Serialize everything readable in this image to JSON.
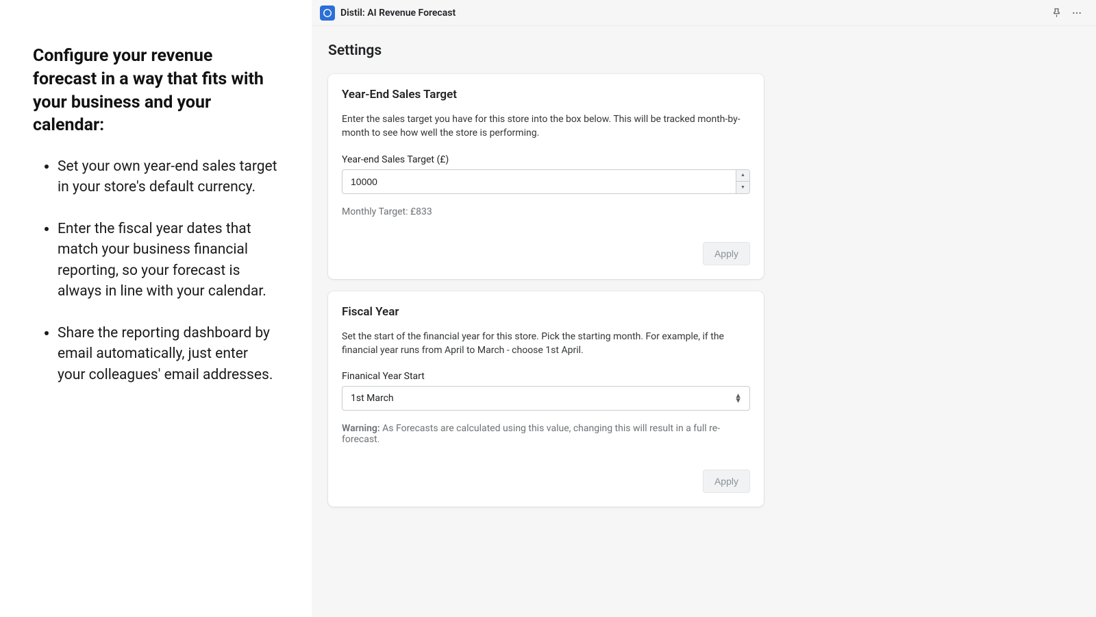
{
  "left": {
    "heading": "Configure your revenue forecast in a way that fits with your business and your calendar:",
    "bullets": [
      "Set your own year-end sales target in your store's default currency.",
      "Enter the fiscal year dates that match your business financial reporting, so your forecast is always in line with your calendar.",
      "Share the reporting dashboard by email automatically, just enter your colleagues' email addresses."
    ]
  },
  "header": {
    "app_title": "Distil: AI Revenue Forecast"
  },
  "page": {
    "title": "Settings"
  },
  "card_target": {
    "title": "Year-End Sales Target",
    "desc": "Enter the sales target you have for this store into the box below. This will be tracked month-by-month to see how well the store is performing.",
    "field_label": "Year-end Sales Target (£)",
    "value": "10000",
    "monthly": "Monthly Target: £833",
    "apply": "Apply"
  },
  "card_fiscal": {
    "title": "Fiscal Year",
    "desc": "Set the start of the financial year for this store. Pick the starting month. For example, if the financial year runs from April to March - choose 1st April.",
    "field_label": "Finanical Year Start",
    "value": "1st March",
    "warning_label": "Warning:",
    "warning_text": " As Forecasts are calculated using this value, changing this will result in a full re-forecast.",
    "apply": "Apply"
  }
}
